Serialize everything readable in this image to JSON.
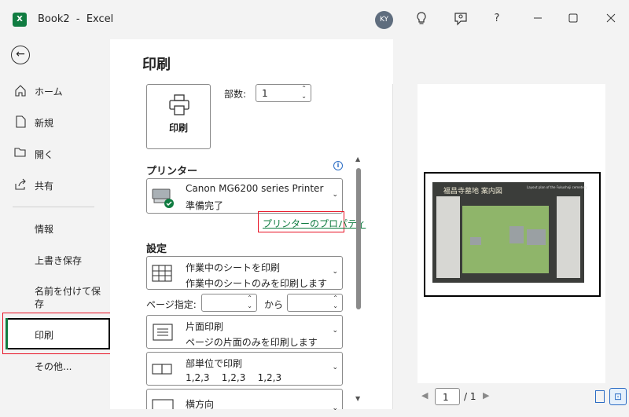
{
  "titlebar": {
    "app_icon": "excel-icon",
    "title": "Book2  -  Excel",
    "avatar": "KY",
    "icons": [
      "lightbulb-icon",
      "feedback-icon",
      "help-icon",
      "minimize-icon",
      "maximize-icon",
      "close-icon"
    ],
    "help_glyph": "?"
  },
  "sidebar": {
    "back_icon": "back-arrow-icon",
    "items": [
      {
        "label": "ホーム",
        "icon": "home-icon"
      },
      {
        "label": "新規",
        "icon": "new-file-icon"
      },
      {
        "label": "開く",
        "icon": "folder-open-icon"
      },
      {
        "label": "共有",
        "icon": "share-icon"
      },
      {
        "label": "情報"
      },
      {
        "label": "上書き保存"
      },
      {
        "label": "名前を付けて保存"
      },
      {
        "label": "印刷"
      },
      {
        "label": "その他..."
      }
    ],
    "selected": "印刷"
  },
  "print": {
    "heading": "印刷",
    "print_button_label": "印刷",
    "copies_label": "部数:",
    "copies_value": "1",
    "printer_section": "プリンター",
    "printer_name": "Canon MG6200 series Printer",
    "printer_status": "準備完了",
    "printer_properties_link": "プリンターのプロパティ",
    "settings_section": "設定",
    "settings": [
      {
        "line1": "作業中のシートを印刷",
        "line2": "作業中のシートのみを印刷します"
      },
      {
        "line1": "片面印刷",
        "line2": "ページの片面のみを印刷します"
      },
      {
        "line1": "部単位で印刷",
        "line2": "1,2,3    1,2,3    1,2,3"
      },
      {
        "line1": "横方向"
      }
    ],
    "pages_label": "ページ指定:",
    "pages_to": "から",
    "pages_from_value": "",
    "pages_to_value": ""
  },
  "preview": {
    "image_title": "福昌寺墓地 案内図",
    "image_subtitle": "Layout plan of the Fukushoji cemetery",
    "current_page": "1",
    "total_pages": "/ 1",
    "view_buttons": [
      "show-margins-icon",
      "zoom-to-page-icon"
    ]
  }
}
